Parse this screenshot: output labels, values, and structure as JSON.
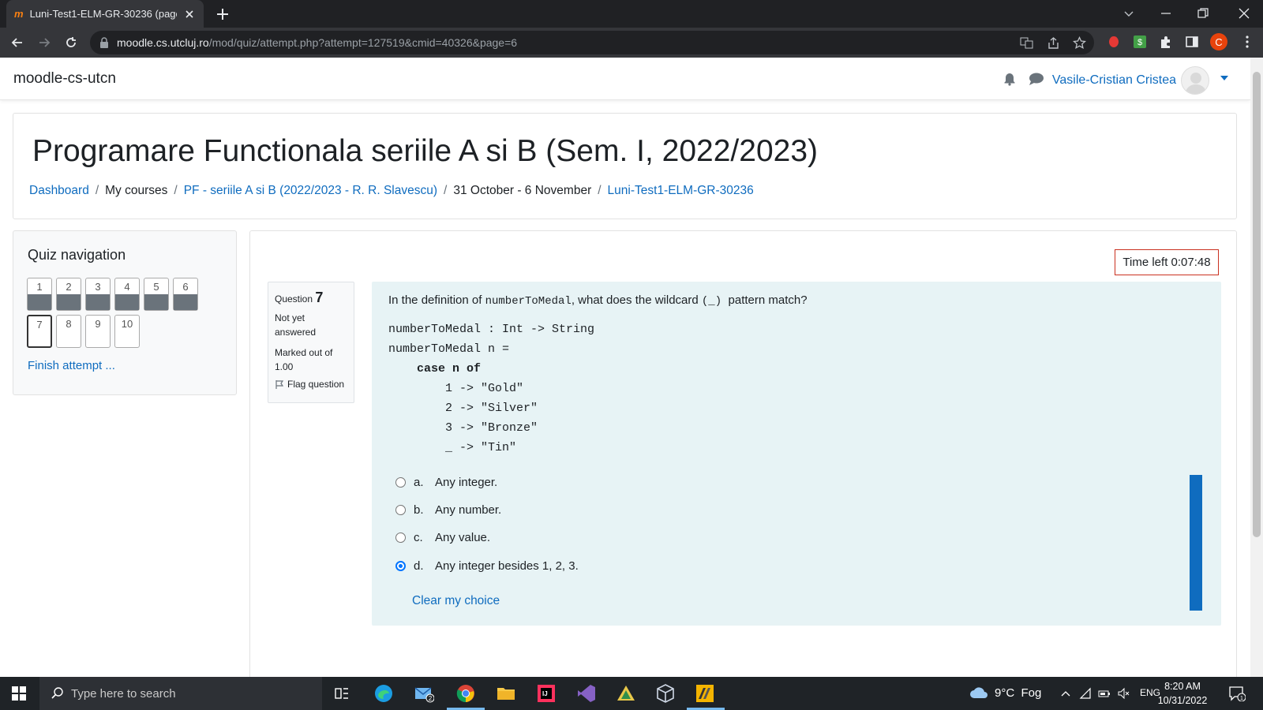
{
  "browser": {
    "tab_title": "Luni-Test1-ELM-GR-30236 (page",
    "url_host": "moodle.cs.utcluj.ro",
    "url_path": "/mod/quiz/attempt.php?attempt=127519&cmid=40326&page=6",
    "profile_initial": "C"
  },
  "site": {
    "brand": "moodle-cs-utcn",
    "user_name": "Vasile-Cristian Cristea"
  },
  "course": {
    "title": "Programare Functionala seriile A si B (Sem. I, 2022/2023)",
    "breadcrumb": [
      {
        "label": "Dashboard",
        "link": true
      },
      {
        "label": "My courses",
        "link": false
      },
      {
        "label": "PF - seriile A si B (2022/2023 - R. R. Slavescu)",
        "link": true
      },
      {
        "label": "31 October - 6 November",
        "link": false
      },
      {
        "label": "Luni-Test1-ELM-GR-30236",
        "link": true
      }
    ]
  },
  "quiz_nav": {
    "heading": "Quiz navigation",
    "buttons": [
      {
        "label": "1",
        "answered": true
      },
      {
        "label": "2",
        "answered": true
      },
      {
        "label": "3",
        "answered": true
      },
      {
        "label": "4",
        "answered": true
      },
      {
        "label": "5",
        "answered": true
      },
      {
        "label": "6",
        "answered": true
      },
      {
        "label": "7",
        "answered": false,
        "current": true
      },
      {
        "label": "8",
        "answered": false
      },
      {
        "label": "9",
        "answered": false
      },
      {
        "label": "10",
        "answered": false
      }
    ],
    "finish_label": "Finish attempt ..."
  },
  "timer": {
    "label": "Time left 0:07:48"
  },
  "question": {
    "prefix": "Question",
    "number": "7",
    "status": "Not yet answered",
    "marked": "Marked out of 1.00",
    "flag_label": "Flag question",
    "text_before": "In the definition of ",
    "text_code": "numberToMedal",
    "text_mid": ", what does the wildcard ",
    "text_code2": " (_) ",
    "text_after": " pattern match?",
    "code_lines": [
      "numberToMedal : Int -> String",
      "numberToMedal n =",
      "    case n of",
      "        1 -> \"Gold\"",
      "        2 -> \"Silver\"",
      "        3 -> \"Bronze\"",
      "        _ -> \"Tin\""
    ],
    "options": [
      {
        "letter": "a.",
        "text": "Any integer.",
        "checked": false
      },
      {
        "letter": "b.",
        "text": "Any number.",
        "checked": false
      },
      {
        "letter": "c.",
        "text": "Any value.",
        "checked": false
      },
      {
        "letter": "d.",
        "text": "Any integer besides 1, 2, 3.",
        "checked": true
      }
    ],
    "clear_label": "Clear my choice"
  },
  "taskbar": {
    "search_placeholder": "Type here to search",
    "weather": "9°C  Fog",
    "language": "ENG",
    "time": "8:20 AM",
    "date": "10/31/2022",
    "mail_badge": "2",
    "notif_count": "1"
  },
  "colors": {
    "moodle_link": "#0f6cbf",
    "question_bg": "#e7f3f5",
    "chrome_dark": "#202124",
    "taskbar": "#1f2327"
  }
}
